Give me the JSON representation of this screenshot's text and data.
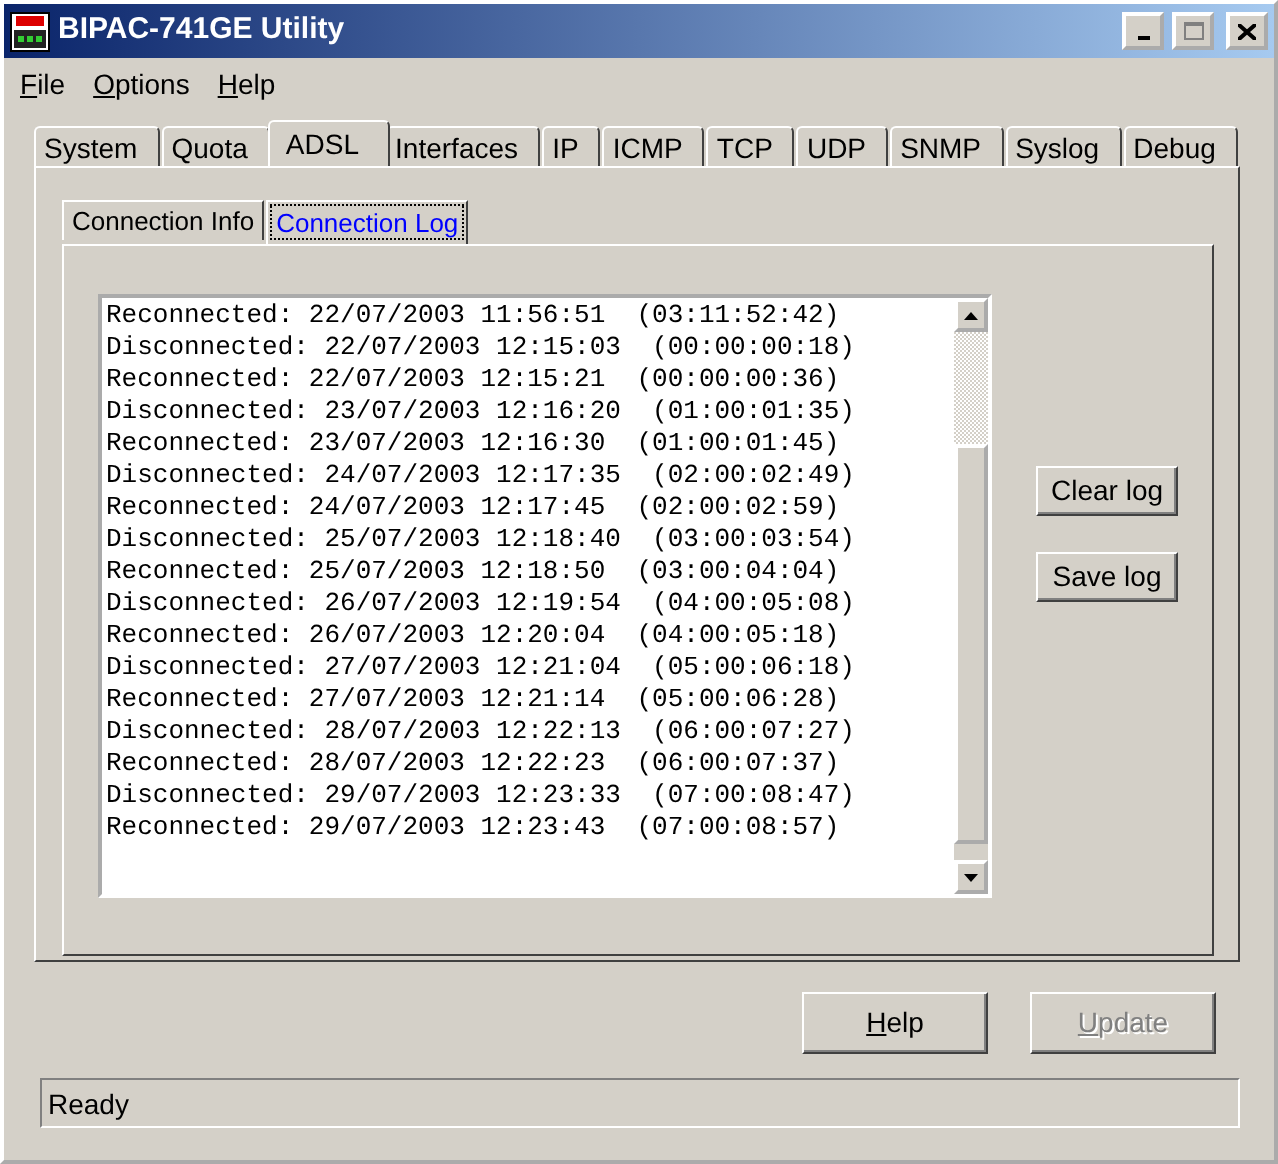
{
  "window": {
    "title": "BIPAC-741GE Utility"
  },
  "menu": [
    {
      "label": "File",
      "underline_first": true
    },
    {
      "label": "Options",
      "underline_first": true
    },
    {
      "label": "Help",
      "underline_first": true
    }
  ],
  "tabs": [
    {
      "label": "System",
      "selected": false
    },
    {
      "label": "Quota",
      "selected": false
    },
    {
      "label": "ADSL",
      "selected": true
    },
    {
      "label": "Interfaces",
      "selected": false
    },
    {
      "label": "IP",
      "selected": false
    },
    {
      "label": "ICMP",
      "selected": false
    },
    {
      "label": "TCP",
      "selected": false
    },
    {
      "label": "UDP",
      "selected": false
    },
    {
      "label": "SNMP",
      "selected": false
    },
    {
      "label": "Syslog",
      "selected": false
    },
    {
      "label": "Debug",
      "selected": false
    }
  ],
  "subtabs": [
    {
      "label": "Connection Info",
      "selected": false
    },
    {
      "label": "Connection Log",
      "selected": true
    }
  ],
  "log": [
    "Reconnected: 22/07/2003 11:56:51  (03:11:52:42)",
    "Disconnected: 22/07/2003 12:15:03  (00:00:00:18)",
    "Reconnected: 22/07/2003 12:15:21  (00:00:00:36)",
    "Disconnected: 23/07/2003 12:16:20  (01:00:01:35)",
    "Reconnected: 23/07/2003 12:16:30  (01:00:01:45)",
    "Disconnected: 24/07/2003 12:17:35  (02:00:02:49)",
    "Reconnected: 24/07/2003 12:17:45  (02:00:02:59)",
    "Disconnected: 25/07/2003 12:18:40  (03:00:03:54)",
    "Reconnected: 25/07/2003 12:18:50  (03:00:04:04)",
    "Disconnected: 26/07/2003 12:19:54  (04:00:05:08)",
    "Reconnected: 26/07/2003 12:20:04  (04:00:05:18)",
    "Disconnected: 27/07/2003 12:21:04  (05:00:06:18)",
    "Reconnected: 27/07/2003 12:21:14  (05:00:06:28)",
    "Disconnected: 28/07/2003 12:22:13  (06:00:07:27)",
    "Reconnected: 28/07/2003 12:22:23  (06:00:07:37)",
    "Disconnected: 29/07/2003 12:23:33  (07:00:08:47)",
    "Reconnected: 29/07/2003 12:23:43  (07:00:08:57)"
  ],
  "log_buttons": [
    {
      "label": "Clear log",
      "disabled": false
    },
    {
      "label": "Save log",
      "disabled": false
    }
  ],
  "buttons": [
    {
      "label": "Help",
      "disabled": false,
      "underline_first": true
    },
    {
      "label": "Update",
      "disabled": true,
      "underline_first": true
    }
  ],
  "status_bar": "Ready"
}
